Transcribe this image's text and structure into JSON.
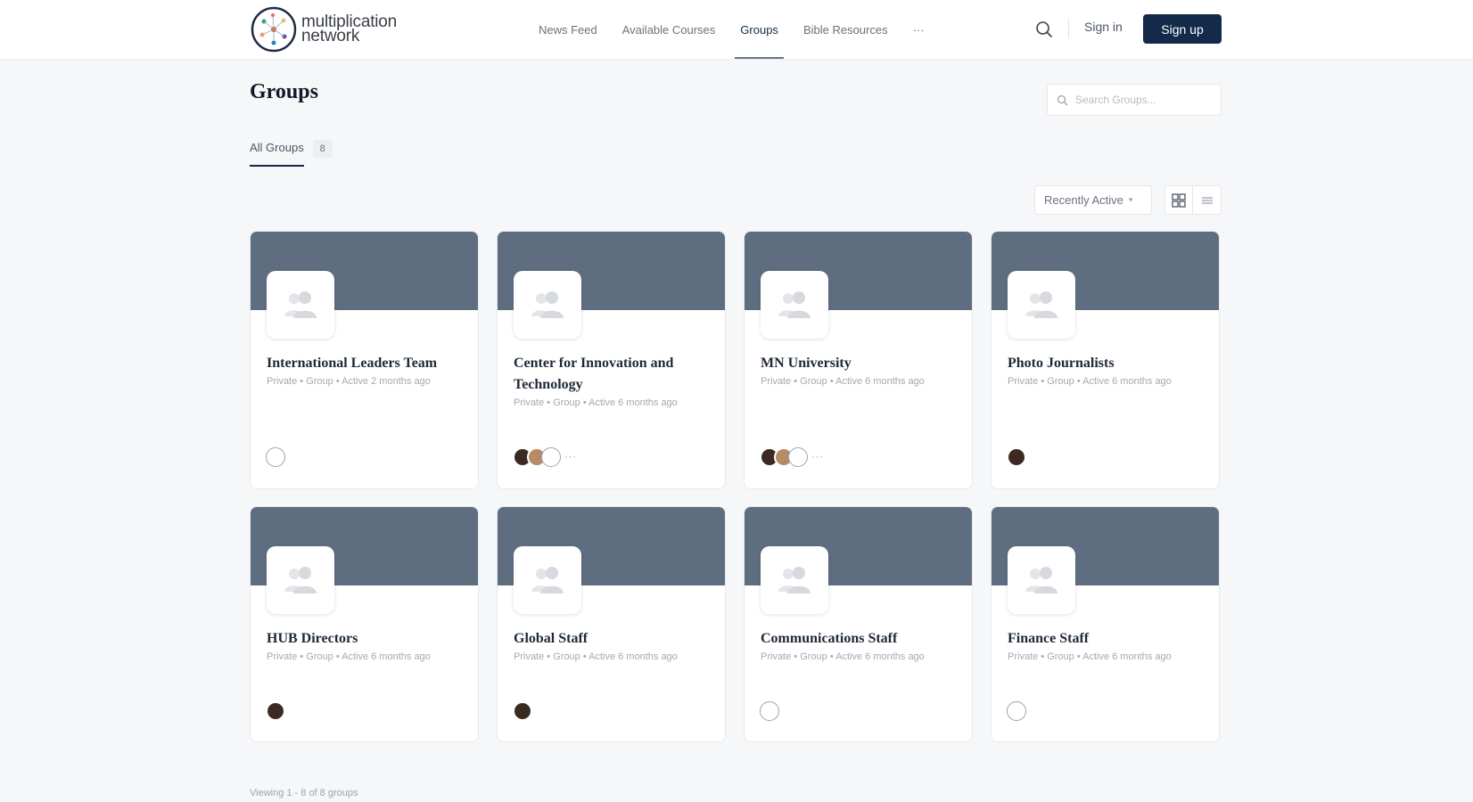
{
  "header": {
    "logo_text_line1": "multiplication",
    "logo_text_line2": "network",
    "nav": [
      "News Feed",
      "Available Courses",
      "Groups",
      "Bible Resources",
      "···"
    ],
    "active_nav": "Groups",
    "signin_label": "Sign in",
    "signup_label": "Sign up"
  },
  "page": {
    "title": "Groups",
    "search_placeholder": "Search Groups...",
    "tab_label": "All Groups",
    "tab_count": "8",
    "sort_label": "Recently Active",
    "footer": "Viewing 1 - 8 of 8 groups"
  },
  "groups": [
    {
      "title": "International Leaders Team",
      "meta": "Private  •  Group  •  Active 2 months ago",
      "members": [
        "globe"
      ]
    },
    {
      "title": "Center for Innovation and Technology",
      "meta": "Private  •  Group  •  Active 6 months ago",
      "members": [
        "dark",
        "tan",
        "globe"
      ],
      "more": "···"
    },
    {
      "title": "MN University",
      "meta": "Private  •  Group  •  Active 6 months ago",
      "members": [
        "dark",
        "tan",
        "globe"
      ],
      "more": "···"
    },
    {
      "title": "Photo Journalists",
      "meta": "Private  •  Group  •  Active 6 months ago",
      "members": [
        "dark"
      ]
    },
    {
      "title": "HUB Directors",
      "meta": "Private  •  Group  •  Active 6 months ago",
      "members": [
        "dark"
      ]
    },
    {
      "title": "Global Staff",
      "meta": "Private  •  Group  •  Active 6 months ago",
      "members": [
        "dark"
      ]
    },
    {
      "title": "Communications Staff",
      "meta": "Private  •  Group  •  Active 6 months ago",
      "members": [
        "globe"
      ]
    },
    {
      "title": "Finance Staff",
      "meta": "Private  •  Group  •  Active 6 months ago",
      "members": [
        "globe"
      ]
    }
  ],
  "colors": {
    "cover": "#5e6e80",
    "signup_bg": "#142a4a"
  },
  "icons": {
    "search": "search-icon",
    "group_placeholder": "group-avatar-icon",
    "grid_view": "grid-view-icon",
    "list_view": "list-view-icon"
  }
}
